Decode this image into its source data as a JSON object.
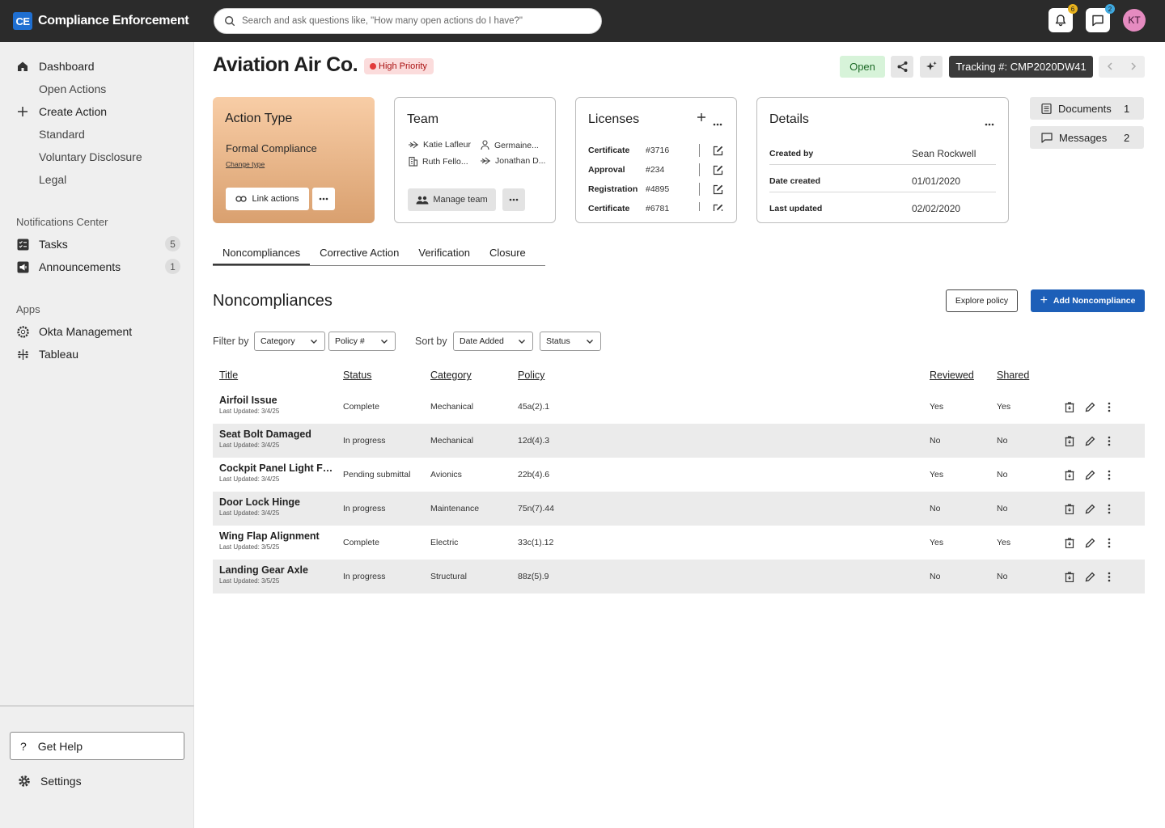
{
  "app": {
    "logo": "CE",
    "name": "Compliance Enforcement",
    "search_placeholder": "Search and ask questions like, \"How many open actions do I have?\"",
    "notifications_count": "6",
    "messages_count": "2",
    "avatar_initials": "KT",
    "colors": {
      "accent": "#1d5fb8",
      "topbar": "#2b2b2b",
      "notif_badge": "#e8b21d",
      "msg_badge": "#3fa9e0"
    }
  },
  "sidebar": {
    "dashboard": "Dashboard",
    "open_actions": "Open Actions",
    "create_action": "Create Action",
    "standard": "Standard",
    "voluntary_disclosure": "Voluntary Disclosure",
    "legal": "Legal",
    "notifications_center": "Notifications Center",
    "tasks": "Tasks",
    "tasks_count": "5",
    "announcements": "Announcements",
    "announcements_count": "1",
    "apps_label": "Apps",
    "okta": "Okta Management",
    "tableau": "Tableau",
    "get_help": "Get Help",
    "settings": "Settings"
  },
  "header": {
    "title": "Aviation Air Co.",
    "priority": "High Priority",
    "status": "Open",
    "tracking": "Tracking #: CMP2020DW41"
  },
  "action_type": {
    "title": "Action Type",
    "value": "Formal Compliance",
    "change_link": "Change type",
    "link_actions": "Link actions"
  },
  "team": {
    "title": "Team",
    "members": [
      "Katie Lafleur",
      "Germaine...",
      "Ruth Fello...",
      "Jonathan D..."
    ],
    "manage": "Manage team"
  },
  "licenses": {
    "title": "Licenses",
    "items": [
      {
        "type": "Certificate",
        "number": "#3716"
      },
      {
        "type": "Approval",
        "number": "#234"
      },
      {
        "type": "Registration",
        "number": "#4895"
      },
      {
        "type": "Certificate",
        "number": "#6781"
      }
    ]
  },
  "details": {
    "title": "Details",
    "rows": [
      {
        "label": "Created by",
        "value": "Sean Rockwell"
      },
      {
        "label": "Date created",
        "value": "01/01/2020"
      },
      {
        "label": "Last updated",
        "value": "02/02/2020"
      }
    ]
  },
  "side_links": {
    "documents": "Documents",
    "documents_count": "1",
    "messages": "Messages",
    "messages_count": "2"
  },
  "tabs": [
    "Noncompliances",
    "Corrective Action",
    "Verification",
    "Closure"
  ],
  "section": {
    "title": "Noncompliances",
    "explore": "Explore policy",
    "add": "Add Noncompliance"
  },
  "filters": {
    "filter_by": "Filter by",
    "category": "Category",
    "policy": "Policy #",
    "sort_by": "Sort by",
    "date_added": "Date Added",
    "status": "Status"
  },
  "table": {
    "headers": {
      "title": "Title",
      "status": "Status",
      "category": "Category",
      "policy": "Policy",
      "reviewed": "Reviewed",
      "shared": "Shared"
    },
    "rows": [
      {
        "title": "Airfoil Issue",
        "updated": "Last Updated: 3/4/25",
        "status": "Complete",
        "category": "Mechanical",
        "policy": "45a(2).1",
        "reviewed": "Yes",
        "shared": "Yes"
      },
      {
        "title": "Seat Bolt Damaged",
        "updated": "Last Updated: 3/4/25",
        "status": "In progress",
        "category": "Mechanical",
        "policy": "12d(4).3",
        "reviewed": "No",
        "shared": "No"
      },
      {
        "title": "Cockpit Panel Light Failure",
        "updated": "Last Updated: 3/4/25",
        "status": "Pending submittal",
        "category": "Avionics",
        "policy": "22b(4).6",
        "reviewed": "Yes",
        "shared": "No"
      },
      {
        "title": "Door Lock Hinge",
        "updated": "Last Updated: 3/4/25",
        "status": "In progress",
        "category": "Maintenance",
        "policy": "75n(7).44",
        "reviewed": "No",
        "shared": "No"
      },
      {
        "title": "Wing Flap Alignment",
        "updated": "Last Updated: 3/5/25",
        "status": "Complete",
        "category": "Electric",
        "policy": "33c(1).12",
        "reviewed": "Yes",
        "shared": "Yes"
      },
      {
        "title": "Landing Gear Axle",
        "updated": "Last Updated: 3/5/25",
        "status": "In progress",
        "category": "Structural",
        "policy": "88z(5).9",
        "reviewed": "No",
        "shared": "No"
      }
    ]
  }
}
